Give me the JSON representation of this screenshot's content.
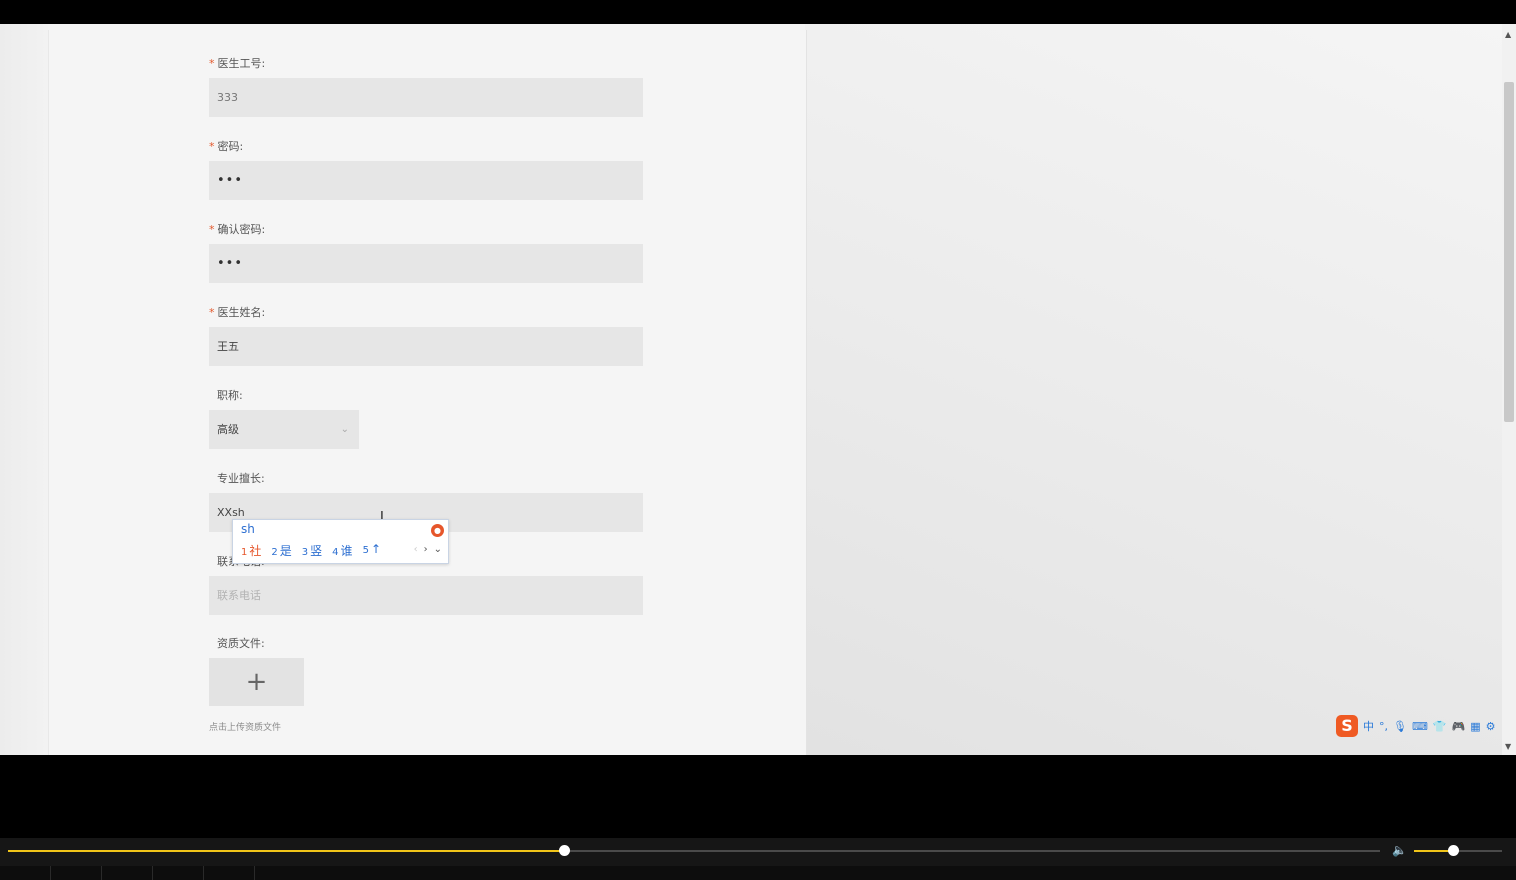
{
  "form": {
    "doctor_id": {
      "label": "医生工号:",
      "value": "333"
    },
    "password": {
      "label": "密码:",
      "value": "•••"
    },
    "confirm_password": {
      "label": "确认密码:",
      "value": "•••"
    },
    "doctor_name": {
      "label": "医生姓名:",
      "value": "王五"
    },
    "title": {
      "label": "职称:",
      "value": "高级"
    },
    "specialty": {
      "label": "专业擅长:",
      "value": "XXsh"
    },
    "phone": {
      "label": "联系电话:",
      "placeholder": "联系电话"
    },
    "qualification": {
      "label": "资质文件:",
      "upload_symbol": "+",
      "hint": "点击上传资质文件"
    }
  },
  "required_mark": "*",
  "ime": {
    "composition": "sh",
    "candidates": [
      {
        "num": "1",
        "text": "社"
      },
      {
        "num": "2",
        "text": "是"
      },
      {
        "num": "3",
        "text": "竖"
      },
      {
        "num": "4",
        "text": "谁"
      },
      {
        "num": "5",
        "text": "↑"
      }
    ],
    "nav": [
      "‹",
      "›",
      "⌄"
    ]
  },
  "ime_toolbar": {
    "logo": "S",
    "mode": "中",
    "punct": "°,"
  },
  "player": {
    "progress": 0.405,
    "volume": 0.44
  },
  "colors": {
    "accent": "#f0c419",
    "required": "#e3572b",
    "ime_blue": "#2d6fd1"
  }
}
